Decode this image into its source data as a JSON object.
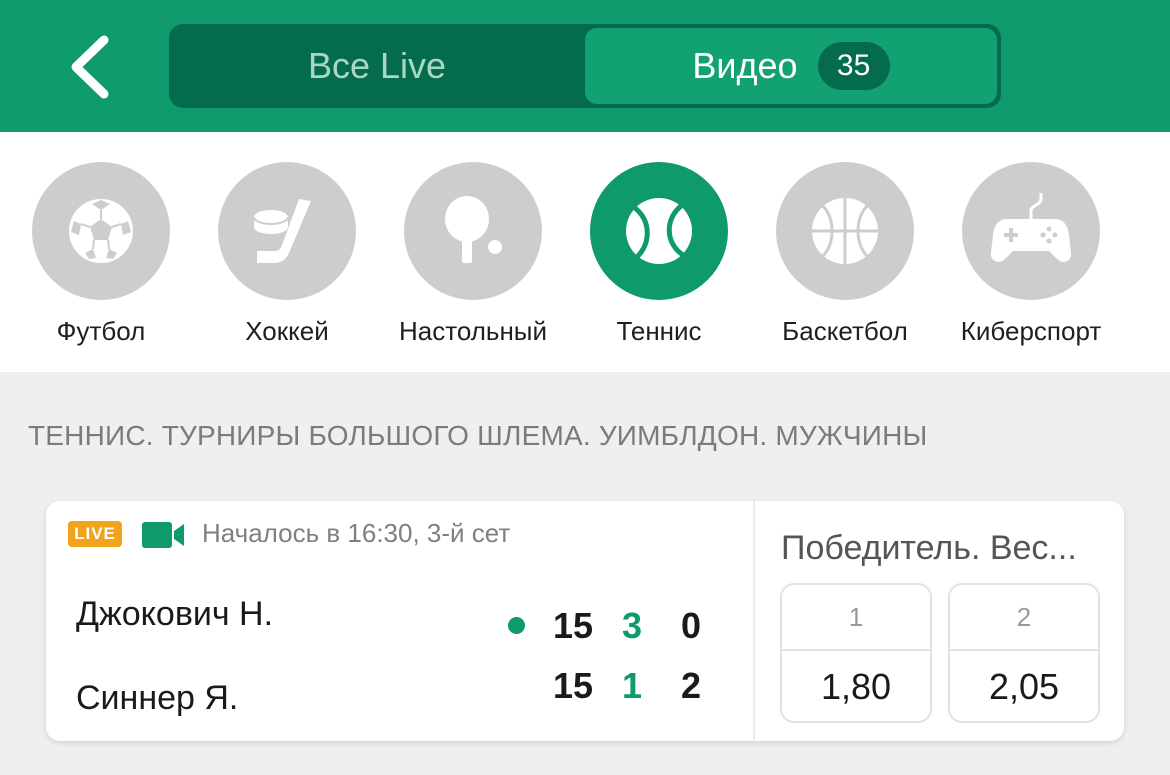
{
  "header": {
    "tabs": [
      {
        "label": "Все Live",
        "active": false
      },
      {
        "label": "Видео",
        "active": true,
        "count": "35"
      }
    ]
  },
  "sports": [
    {
      "label": "Футбол",
      "icon": "soccer-ball-icon",
      "active": false
    },
    {
      "label": "Хоккей",
      "icon": "hockey-icon",
      "active": false
    },
    {
      "label": "Настольный",
      "icon": "table-tennis-icon",
      "active": false
    },
    {
      "label": "Теннис",
      "icon": "tennis-ball-icon",
      "active": true
    },
    {
      "label": "Баскетбол",
      "icon": "basketball-icon",
      "active": false
    },
    {
      "label": "Киберспорт",
      "icon": "gamepad-icon",
      "active": false
    }
  ],
  "section": {
    "title": "ТЕННИС. ТУРНИРЫ БОЛЬШОГО ШЛЕМА. УИМБЛДОН. МУЖЧИНЫ"
  },
  "match": {
    "live_label": "LIVE",
    "started": "Началось в 16:30, 3-й сет",
    "players": [
      {
        "name": "Джокович Н.",
        "serving": true,
        "points": "15",
        "games": "3",
        "sets": "0"
      },
      {
        "name": "Синнер Я.",
        "serving": false,
        "points": "15",
        "games": "1",
        "sets": "2"
      }
    ],
    "market": "Победитель. Вес...",
    "odds": [
      {
        "label": "1",
        "value": "1,80"
      },
      {
        "label": "2",
        "value": "2,05"
      }
    ]
  },
  "colors": {
    "brand_green": "#0f9a6e",
    "dark_green": "#056b4d",
    "live_orange": "#f0a31b",
    "inactive_grey": "#cdcdcd"
  }
}
